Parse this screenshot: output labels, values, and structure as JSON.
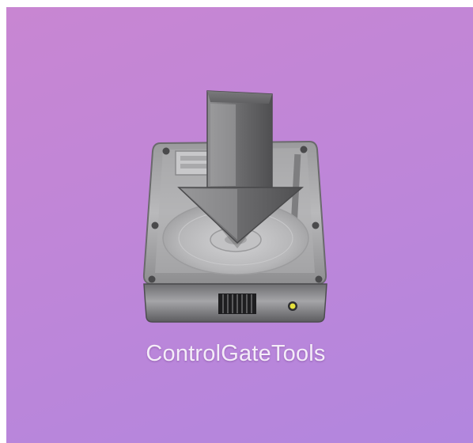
{
  "desktop": {
    "icon": {
      "label": "ControlGateTools",
      "graphic": "disk-image-download-icon"
    },
    "colors": {
      "background_top": "#c886d2",
      "background_bottom": "#b286de",
      "label": "#f4ecf8"
    }
  }
}
